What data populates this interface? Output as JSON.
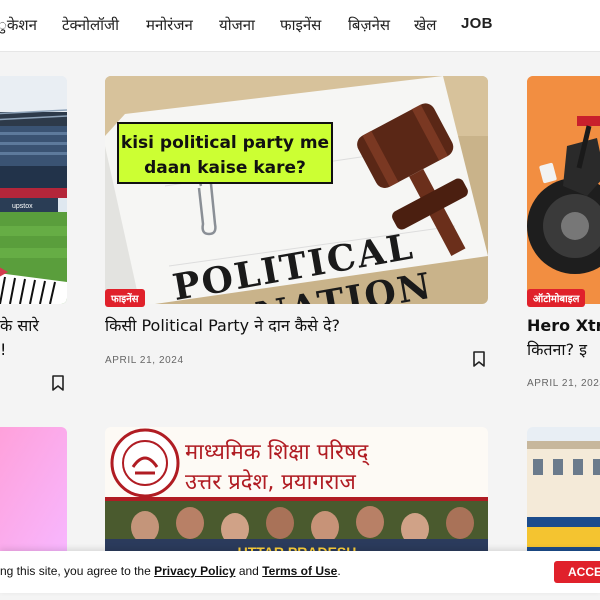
{
  "nav": {
    "items": [
      "ुकेशन",
      "टेक्नोलॉजी",
      "मनोरंजन",
      "योजना",
      "फाइनेंस",
      "बिज़नेस",
      "खेल",
      "JOB"
    ]
  },
  "cards": [
    {
      "title_line1": "के सारे",
      "title_line2": "!",
      "image_text": "upstox"
    },
    {
      "badge": "फाइनेंस",
      "title": "किसी Political Party ने दान कैसे दे?",
      "date": "APRIL 21, 2024",
      "image_caption": "kisi political party me daan kaise kare?",
      "image_caption_line1": "kisi political party me",
      "image_caption_line2": "daan kaise kare?",
      "image_heading_line1": "POLITICAL",
      "image_heading_line2": "DONATION"
    },
    {
      "badge": "ऑटोमोबाइल",
      "title_line1": "Hero Xtr",
      "title_line2": "कितना? इ",
      "date": "APRIL 21, 2024"
    },
    {},
    {
      "image_line1": "माध्यमिक शिक्षा परिषद्",
      "image_line2": "उत्तर प्रदेश, प्रयागराज",
      "image_bottom": "UTTAR PRADESH"
    },
    {}
  ],
  "cookie": {
    "text_before": "ng this site, you agree to the ",
    "privacy": "Privacy Policy",
    "and": " and ",
    "terms": "Terms of Use",
    "end": ".",
    "accept": "ACCE"
  },
  "colors": {
    "accent": "#e0212b",
    "caption_bg": "#ccff33"
  }
}
